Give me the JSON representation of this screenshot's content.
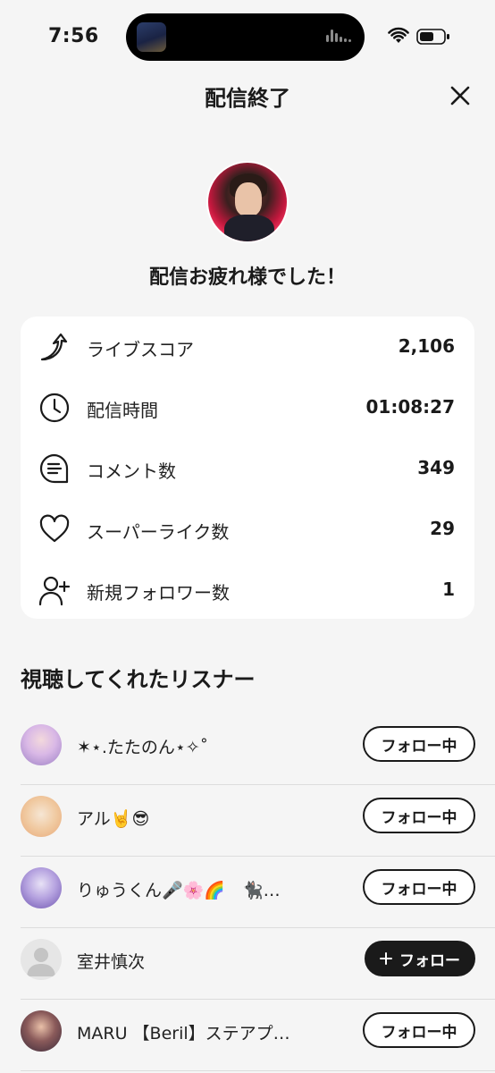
{
  "status_bar": {
    "time": "7:56"
  },
  "header": {
    "title": "配信終了"
  },
  "congrats": "配信お疲れ様でした！",
  "stats": [
    {
      "label": "ライブスコア",
      "value": "2,106",
      "icon": "live-score-icon"
    },
    {
      "label": "配信時間",
      "value": "01:08:27",
      "icon": "clock-icon"
    },
    {
      "label": "コメント数",
      "value": "349",
      "icon": "comment-icon"
    },
    {
      "label": "スーパーライク数",
      "value": "29",
      "icon": "heart-icon"
    },
    {
      "label": "新規フォロワー数",
      "value": "1",
      "icon": "add-user-icon"
    }
  ],
  "listeners_section": {
    "title": "視聴してくれたリスナー"
  },
  "listeners": [
    {
      "name": "✶⋆.たたのん⋆✧˚",
      "button": "フォロー中",
      "following": true
    },
    {
      "name": "アル🤘😎",
      "button": "フォロー中",
      "following": true
    },
    {
      "name": "りゅうくん🎤🌸🌈　🐈‍⬛…",
      "button": "フォロー中",
      "following": true
    },
    {
      "name": "室井慎次",
      "button": "フォロー",
      "following": false
    },
    {
      "name": "MARU 【Beril】ステアプ…",
      "button": "フォロー中",
      "following": true
    }
  ],
  "colors": {
    "background": "#f5f5f5",
    "card": "#ffffff",
    "primary": "#1a1a1a"
  }
}
